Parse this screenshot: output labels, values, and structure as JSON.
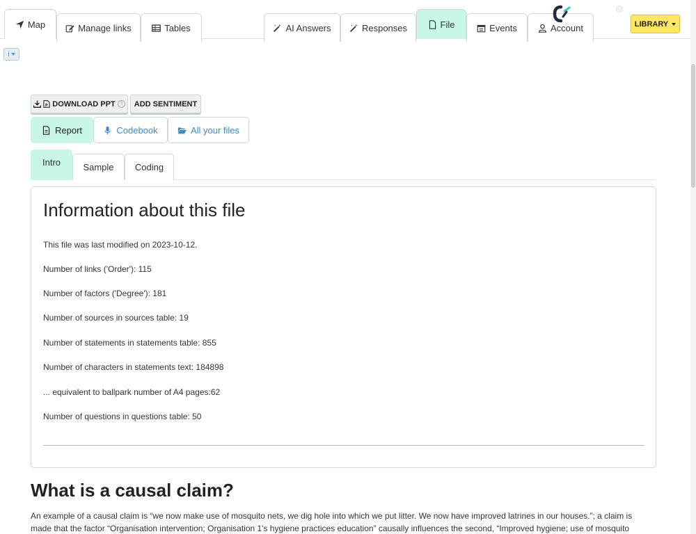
{
  "nav": {
    "map": "Map",
    "manage_links": "Manage links",
    "tables": "Tables",
    "ai_answers": "AI Answers",
    "responses": "Responses",
    "file": "File",
    "events": "Events",
    "account": "Account",
    "library": "LIBRARY"
  },
  "info_toggle": "i",
  "actions": {
    "download_ppt": "DOWNLOAD PPT",
    "help": "?",
    "add_sentiment": "ADD SENTIMENT"
  },
  "pills": {
    "report": "Report",
    "codebook": "Codebook",
    "all_files": "All your files"
  },
  "subtabs": {
    "intro": "Intro",
    "sample": "Sample",
    "coding": "Coding"
  },
  "card": {
    "title": "Information about this file",
    "stats": [
      "This file was last modified on 2023-10-12.",
      "Number of links ('Order'): 115",
      "Number of factors ('Degree'): 181",
      "Number of sources in sources table: 19",
      "Number of statements in statements table: 855",
      "Number of characters in statements text: 184898",
      "... equivalent to ballpark number of A4 pages:62",
      "Number of questions in questions table: 50"
    ]
  },
  "causal": {
    "title": "What is a causal claim?",
    "paragraph": "An example of a causal claim is “we now make use of mosquito nets, we dig hole into which we put litter. We now have improved latrines in our houses.”; a claim is made that the factor “Organisation intervention; Organisation 1's hygiene practices education” causally influences the second, “Improved hygiene; use of mosquito"
  },
  "colors": {
    "active_tab": "#c8f7e8",
    "library": "#ffe766",
    "link": "#3a8ec7"
  }
}
